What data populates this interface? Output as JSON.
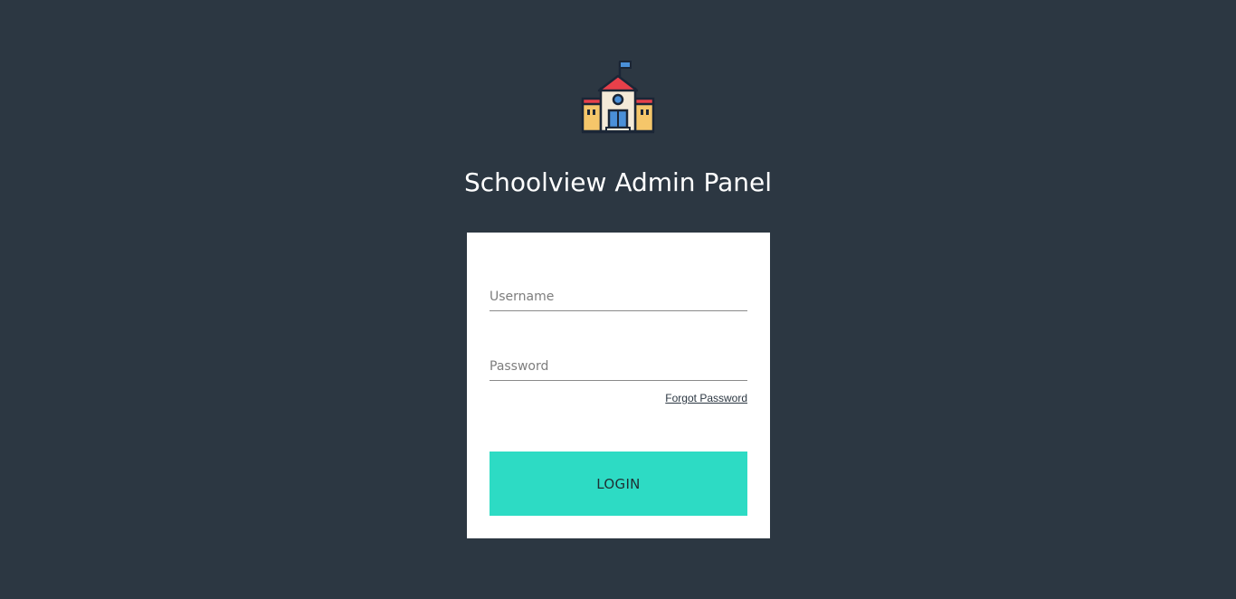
{
  "app": {
    "logo_icon": "school-building-icon",
    "title": "Schoolview Admin Panel"
  },
  "form": {
    "username": {
      "placeholder": "Username",
      "value": ""
    },
    "password": {
      "placeholder": "Password",
      "value": ""
    },
    "forgot_password_label": "Forgot Password",
    "login_label": "LOGIN"
  },
  "colors": {
    "background": "#2c3742",
    "card": "#ffffff",
    "accent": "#2ddbc4"
  }
}
